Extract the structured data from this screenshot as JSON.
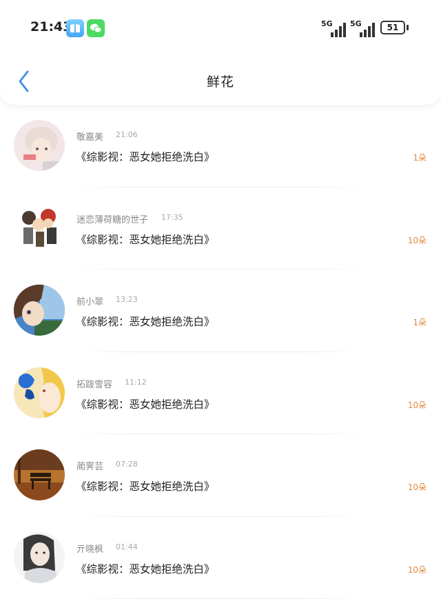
{
  "status_bar": {
    "time": "21:43",
    "signal1": "5G",
    "signal2": "5G",
    "battery": "51"
  },
  "header": {
    "title": "鲜花"
  },
  "items": [
    {
      "name": "敬嘉美",
      "time": "21:06",
      "book": "《综影视：恶女她拒绝洗白》",
      "count": "1朵"
    },
    {
      "name": "迷恋薄荷糖的世子",
      "time": "17:35",
      "book": "《综影视：恶女她拒绝洗白》",
      "count": "10朵"
    },
    {
      "name": "前小翠",
      "time": "13:23",
      "book": "《综影视：恶女她拒绝洗白》",
      "count": "1朵"
    },
    {
      "name": "拓跋雪容",
      "time": "11:12",
      "book": "《综影视：恶女她拒绝洗白》",
      "count": "10朵"
    },
    {
      "name": "蔺霁芸",
      "time": "07:28",
      "book": "《综影视：恶女她拒绝洗白》",
      "count": "10朵"
    },
    {
      "name": "亓晓枫",
      "time": "01:44",
      "book": "《综影视：恶女她拒绝洗白》",
      "count": "10朵"
    }
  ],
  "colors": {
    "accent": "#4a90e2",
    "count": "#e08a3c"
  }
}
